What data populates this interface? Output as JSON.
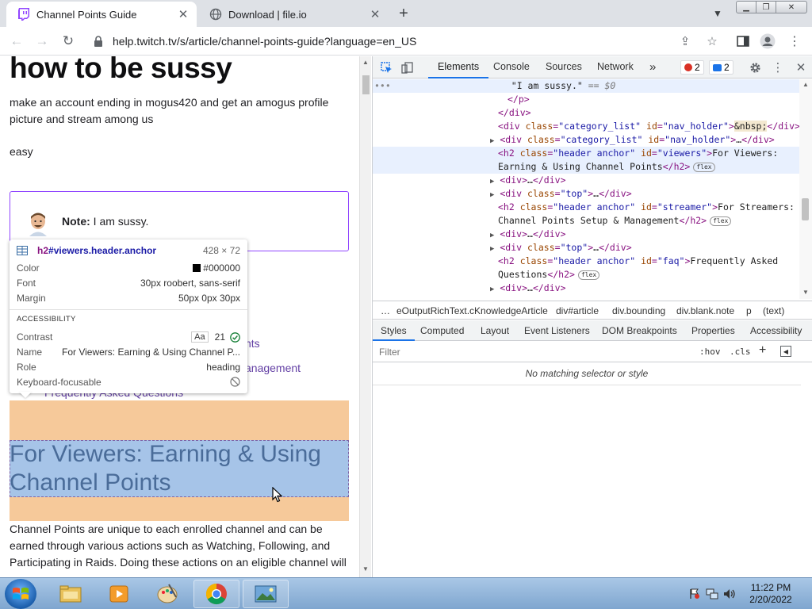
{
  "browser": {
    "tabs": [
      {
        "title": "Channel Points Guide",
        "active": true
      },
      {
        "title": "Download | file.io",
        "active": false
      }
    ],
    "url": "help.twitch.tv/s/article/channel-points-guide?language=en_US"
  },
  "page": {
    "title": "how to be sussy",
    "intro": "make an account ending in mogus420 and get an amogus profile picture and stream among us",
    "easy": "easy",
    "note_label": "Note:",
    "note_text": " I am sussy.",
    "toc_visible_1": "nts",
    "toc_visible_2": "anagement",
    "toc_visible_3": "Frequently Asked Questions",
    "h2": "For Viewers: Earning & Using Channel Points",
    "body_text": "Channel Points are unique to each enrolled channel and can be earned through various actions such as Watching, Following, and Participating in Raids. Doing these actions on an eligible channel will"
  },
  "tooltip": {
    "selector_tag": "h2",
    "selector_rest": "#viewers.header.anchor",
    "size": "428 × 72",
    "color_label": "Color",
    "color_value": "#000000",
    "font_label": "Font",
    "font_value": "30px roobert, sans-serif",
    "margin_label": "Margin",
    "margin_value": "50px 0px 30px",
    "accessibility_heading": "ACCESSIBILITY",
    "contrast_label": "Contrast",
    "contrast_aa": "Aa",
    "contrast_value": "21",
    "name_label": "Name",
    "name_value": "For Viewers: Earning & Using Channel P...",
    "role_label": "Role",
    "role_value": "heading",
    "keyboard_label": "Keyboard-focusable"
  },
  "devtools": {
    "tabs": [
      "Elements",
      "Console",
      "Sources",
      "Network"
    ],
    "more": "»",
    "errors": "2",
    "messages": "2",
    "dom": {
      "l0": "\"I am sussy.\"",
      "l0_eq": " == $0",
      "l1": "</p>",
      "l2": "</div>",
      "l3_tag": "div",
      "class_attr": "class",
      "id_attr": "id",
      "category_list": "\"category_list\"",
      "nav_holder": "\"nav_holder\"",
      "nbsp": "&nbsp;",
      "ellipsis": "…",
      "h2_header_anchor": "\"header anchor\"",
      "viewers_id": "\"viewers\"",
      "viewers_text_1": "For Viewers:",
      "viewers_text_2": "Earning & Using Channel Points",
      "top_class": "\"top\"",
      "streamer_id": "\"streamer\"",
      "streamer_text_1": "For Streamers:",
      "streamer_text_2": "Channel Points Setup & Management",
      "faq_id": "\"faq\"",
      "faq_text_1": "Frequently Asked",
      "faq_text_2": "Questions",
      "flex": "flex"
    },
    "breadcrumbs": [
      "…",
      "eOutputRichText.cKnowledgeArticle",
      "div#article",
      "div.bounding",
      "div.blank.note",
      "p",
      "(text)"
    ],
    "style_tabs": [
      "Styles",
      "Computed",
      "Layout",
      "Event Listeners",
      "DOM Breakpoints",
      "Properties",
      "Accessibility"
    ],
    "filter_placeholder": "Filter",
    "hov": ":hov",
    "cls": ".cls",
    "no_match": "No matching selector or style"
  },
  "taskbar": {
    "time": "11:22 PM",
    "date": "2/20/2022"
  }
}
